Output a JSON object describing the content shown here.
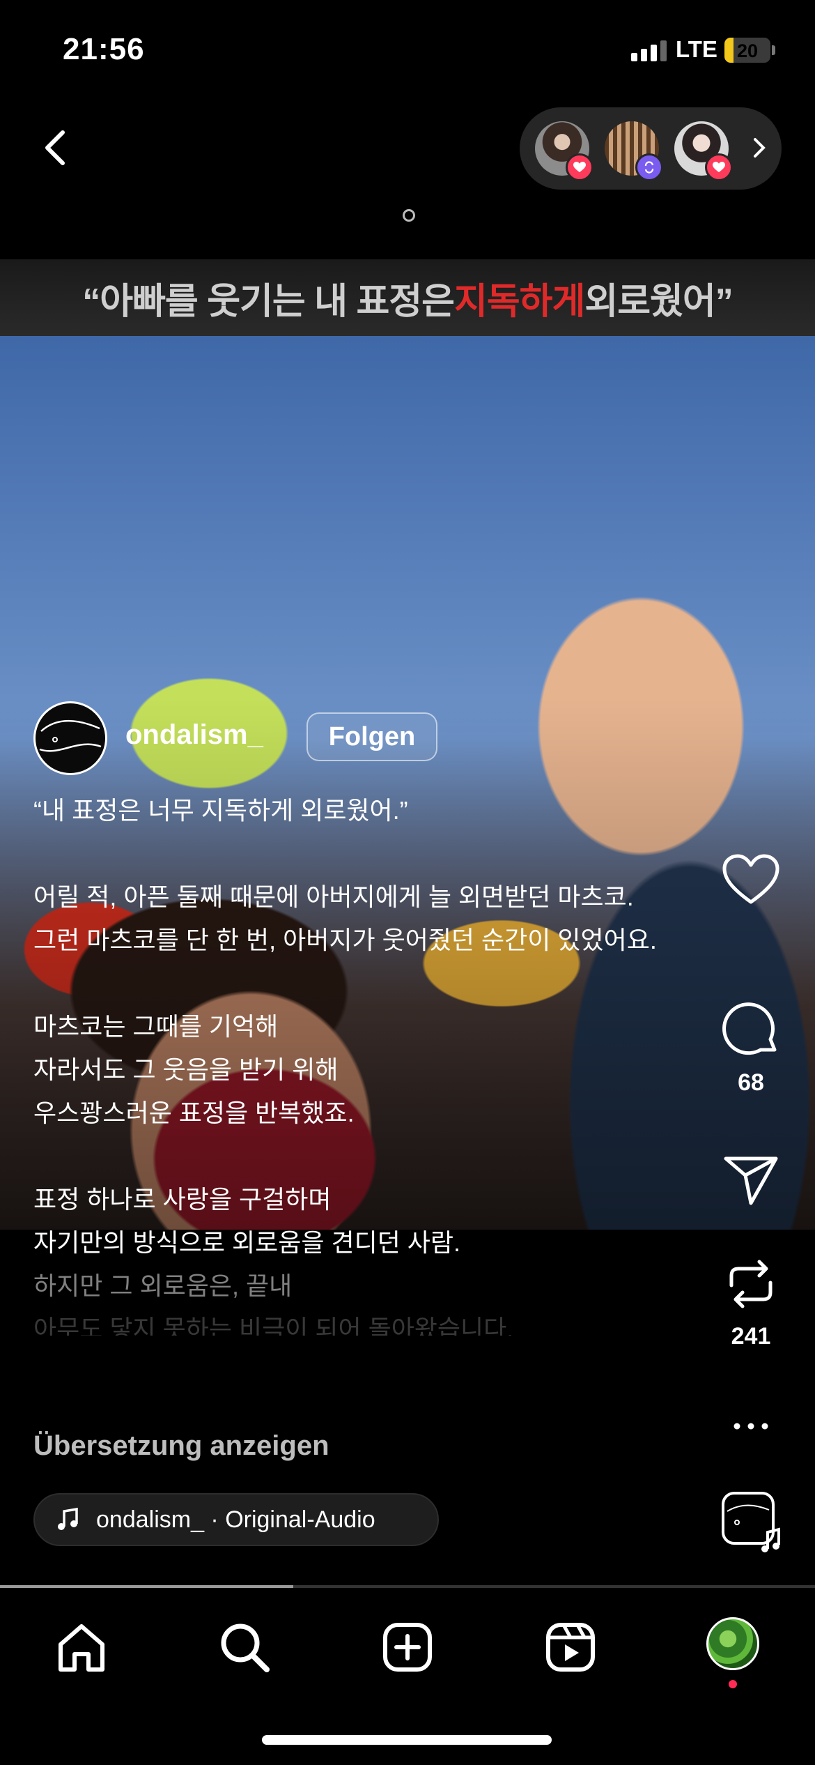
{
  "status_bar": {
    "time": "21:56",
    "network": "LTE",
    "battery": "20",
    "battery_level": 0.2
  },
  "header": {
    "viewers": [
      {
        "name": "viewer-1",
        "badge": "heart-icon"
      },
      {
        "name": "viewer-2",
        "badge": "repost-icon"
      },
      {
        "name": "viewer-3",
        "badge": "heart-icon"
      }
    ]
  },
  "video": {
    "caption_open": "“아빠를 웃기는 내 표정은 ",
    "caption_highlight": "지독하게",
    "caption_close": " 외로웠어”",
    "colors": {
      "highlight": "#e02a2a"
    }
  },
  "post": {
    "author": "ondalism_",
    "follow_label": "Folgen",
    "lines": [
      "“내 표정은 너무 지독하게 외로웠어.”",
      "",
      "어릴 적, 아픈 둘째 때문에 아버지에게 늘 외면받던 마츠코.",
      "그런 마츠코를 단 한 번, 아버지가 웃어줬던 순간이 있었어요.",
      "",
      "마츠코는 그때를 기억해",
      "자라서도 그 웃음을 받기 위해",
      "우스꽝스러운 표정을 반복했죠.",
      "",
      "표정 하나로 사랑을 구걸하며",
      "자기만의 방식으로 외로움을 견디던 사람.",
      "하지만 그 외로움은, 끝내",
      "아무도 닿지 못하는 비극이 되어 돌아왔습니다."
    ],
    "translate_label": "Übersetzung anzeigen",
    "audio_label": "ondalism_ · Original-Audio"
  },
  "actions": {
    "like_icon": "heart-icon",
    "comment_icon": "comment-icon",
    "comments": "68",
    "share_icon": "send-icon",
    "repost_icon": "repost-icon",
    "reposts": "241",
    "more_icon": "more-icon"
  },
  "playback": {
    "progress": 0.36
  },
  "nav": {
    "items": [
      "home-icon",
      "search-icon",
      "create-icon",
      "reels-icon",
      "profile-avatar"
    ],
    "colors": {
      "notification_dot": "#ff2d55"
    }
  }
}
